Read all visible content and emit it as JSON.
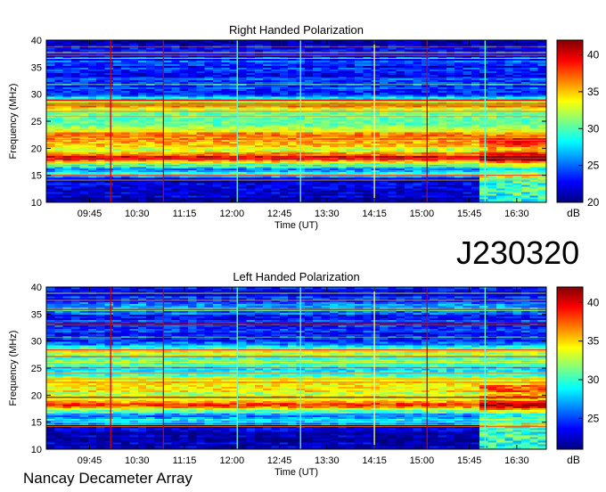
{
  "observation_id": "J230320",
  "facility": "Nancay Decameter Array",
  "colors": {
    "colormap": [
      "#00007f",
      "#0000ff",
      "#007fff",
      "#00ffff",
      "#7fff7f",
      "#ffff00",
      "#ff7f00",
      "#ff0000",
      "#7f0000"
    ]
  },
  "chart_data": [
    {
      "type": "heatmap",
      "title": "Right Handed Polarization",
      "xlabel": "Time (UT)",
      "ylabel": "Frequency (MHz)",
      "colorbar_label": "dB",
      "x_ticks": [
        "09:45",
        "10:30",
        "11:15",
        "12:00",
        "12:45",
        "13:30",
        "14:15",
        "15:00",
        "15:45",
        "16:30"
      ],
      "y_ticks": [
        10,
        15,
        20,
        25,
        30,
        35,
        40
      ],
      "ylim": [
        10,
        40
      ],
      "colorbar_ticks": [
        20,
        25,
        30,
        35,
        40
      ],
      "colorbar_range": [
        20,
        42
      ],
      "xlim": [
        "09:04",
        "16:58"
      ],
      "intensity_profile": [
        {
          "freq": 10,
          "db": 20.5
        },
        {
          "freq": 11.5,
          "db": 21
        },
        {
          "freq": 14.5,
          "db": 22
        },
        {
          "freq": 15.3,
          "db": 30
        },
        {
          "freq": 16,
          "db": 25
        },
        {
          "freq": 17,
          "db": 29
        },
        {
          "freq": 18,
          "db": 40
        },
        {
          "freq": 19,
          "db": 37
        },
        {
          "freq": 20,
          "db": 33
        },
        {
          "freq": 21,
          "db": 36
        },
        {
          "freq": 22,
          "db": 38
        },
        {
          "freq": 23,
          "db": 34
        },
        {
          "freq": 24.5,
          "db": 31
        },
        {
          "freq": 25.5,
          "db": 30
        },
        {
          "freq": 27,
          "db": 32
        },
        {
          "freq": 28,
          "db": 36
        },
        {
          "freq": 29,
          "db": 30
        },
        {
          "freq": 30,
          "db": 25
        },
        {
          "freq": 32,
          "db": 24
        },
        {
          "freq": 35,
          "db": 23
        },
        {
          "freq": 36,
          "db": 24
        },
        {
          "freq": 38,
          "db": 22.5
        },
        {
          "freq": 40,
          "db": 22
        }
      ],
      "vertical_markers": [
        {
          "time": "10:05",
          "color": "#c80000"
        },
        {
          "time": "10:55",
          "color": "#c80000"
        },
        {
          "time": "12:05",
          "color": "#60ffd0"
        },
        {
          "time": "13:05",
          "color": "#60ffd0"
        },
        {
          "time": "14:15",
          "color": "#ffff80"
        },
        {
          "time": "15:05",
          "color": "#c80000"
        },
        {
          "time": "16:00",
          "color": "#60ffd0"
        }
      ]
    },
    {
      "type": "heatmap",
      "title": "Left Handed Polarization",
      "xlabel": "Time (UT)",
      "ylabel": "Frequency (MHz)",
      "colorbar_label": "dB",
      "x_ticks": [
        "09:45",
        "10:30",
        "11:15",
        "12:00",
        "12:45",
        "13:30",
        "14:15",
        "15:00",
        "15:45",
        "16:30"
      ],
      "y_ticks": [
        10,
        15,
        20,
        25,
        30,
        35,
        40
      ],
      "ylim": [
        10,
        40
      ],
      "colorbar_ticks": [
        25,
        30,
        35,
        40
      ],
      "colorbar_range": [
        21,
        42
      ],
      "xlim": [
        "09:04",
        "16:58"
      ],
      "intensity_profile": [
        {
          "freq": 10,
          "db": 21.5
        },
        {
          "freq": 11.5,
          "db": 22
        },
        {
          "freq": 14.5,
          "db": 22.5
        },
        {
          "freq": 15.3,
          "db": 30
        },
        {
          "freq": 16,
          "db": 25
        },
        {
          "freq": 17,
          "db": 30
        },
        {
          "freq": 18,
          "db": 38
        },
        {
          "freq": 19,
          "db": 35
        },
        {
          "freq": 20,
          "db": 33
        },
        {
          "freq": 21,
          "db": 34
        },
        {
          "freq": 22,
          "db": 36
        },
        {
          "freq": 23,
          "db": 33
        },
        {
          "freq": 24.5,
          "db": 30
        },
        {
          "freq": 25.5,
          "db": 29
        },
        {
          "freq": 27,
          "db": 31
        },
        {
          "freq": 28,
          "db": 34
        },
        {
          "freq": 29,
          "db": 29
        },
        {
          "freq": 30,
          "db": 25
        },
        {
          "freq": 32,
          "db": 24
        },
        {
          "freq": 35,
          "db": 24
        },
        {
          "freq": 36,
          "db": 28
        },
        {
          "freq": 38,
          "db": 24
        },
        {
          "freq": 40,
          "db": 23
        }
      ],
      "vertical_markers": [
        {
          "time": "10:05",
          "color": "#c80000"
        },
        {
          "time": "10:55",
          "color": "#c80000"
        },
        {
          "time": "12:05",
          "color": "#60ffd0"
        },
        {
          "time": "13:05",
          "color": "#60ffd0"
        },
        {
          "time": "14:15",
          "color": "#ffff80"
        },
        {
          "time": "15:05",
          "color": "#c80000"
        },
        {
          "time": "16:00",
          "color": "#60ffd0"
        }
      ]
    }
  ]
}
